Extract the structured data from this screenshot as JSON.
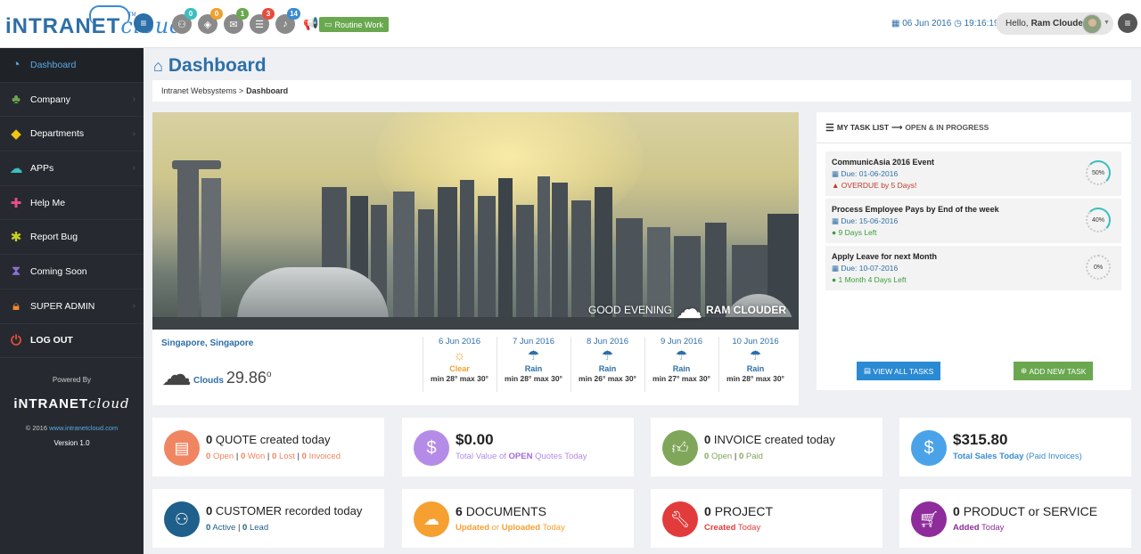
{
  "colors": {
    "brand": "#2d6fa8",
    "sidebar_bg": "#262a30",
    "accent_blue": "#5aa9e6"
  },
  "header": {
    "logo_left": "iNTRANET",
    "logo_right": "cloud",
    "logo_tm": "TM",
    "badges": [
      {
        "icon": "users-icon",
        "count": "0",
        "color": "#3bbfbf"
      },
      {
        "icon": "cube-icon",
        "count": "0",
        "color": "#f0a030"
      },
      {
        "icon": "chat-icon",
        "count": "1",
        "color": "#6aa84f"
      },
      {
        "icon": "list-icon",
        "count": "3",
        "color": "#e74c3c"
      },
      {
        "icon": "bell-icon",
        "count": "14",
        "color": "#3a8bd0"
      }
    ],
    "routine_label": "Routine Work",
    "date": "06 Jun 2016",
    "time": "19:16:19",
    "greeting": "Hello,",
    "user_name": "Ram Clouder"
  },
  "sidebar": {
    "items": [
      {
        "label": "Dashboard",
        "icon": "dashboard-icon"
      },
      {
        "label": "Company",
        "icon": "sitemap-icon"
      },
      {
        "label": "Departments",
        "icon": "cubes-icon"
      },
      {
        "label": "APPs",
        "icon": "cloud-icon"
      },
      {
        "label": "Help Me",
        "icon": "medkit-icon"
      },
      {
        "label": "Report Bug",
        "icon": "bug-icon"
      },
      {
        "label": "Coming Soon",
        "icon": "hourglass-icon"
      },
      {
        "label": "SUPER ADMIN",
        "icon": "lock-icon"
      },
      {
        "label": "LOG OUT",
        "icon": "power-icon"
      }
    ],
    "powered_by": "Powered By",
    "copyright": "© 2016",
    "copyright_link": "www.intranetcloud.com",
    "version": "Version 1.0"
  },
  "page": {
    "title": "Dashboard",
    "breadcrumb_root": "Intranet Websystems",
    "breadcrumb_sep": ">",
    "breadcrumb_current": "Dashboard"
  },
  "hero": {
    "greeting": "GOOD EVENING",
    "name": "RAM CLOUDER"
  },
  "weather": {
    "city": "Singapore, Singapore",
    "current_condition": "Clouds",
    "current_temp": "29.86",
    "degree": "o",
    "forecast": [
      {
        "date": "6 Jun 2016",
        "condition": "Clear",
        "range": "min 28° max 30°",
        "icon": "sun-icon"
      },
      {
        "date": "7 Jun 2016",
        "condition": "Rain",
        "range": "min 28° max 30°",
        "icon": "rain-icon"
      },
      {
        "date": "8 Jun 2016",
        "condition": "Rain",
        "range": "min 26° max 30°",
        "icon": "rain-icon"
      },
      {
        "date": "9 Jun 2016",
        "condition": "Rain",
        "range": "min 27° max 30°",
        "icon": "rain-icon"
      },
      {
        "date": "10 Jun 2016",
        "condition": "Rain",
        "range": "min 28° max 30°",
        "icon": "rain-icon"
      }
    ]
  },
  "tasks": {
    "heading": "MY TASK LIST",
    "heading_sub": "OPEN & IN PROGRESS",
    "items": [
      {
        "title": "CommunicAsia 2016 Event",
        "due": "Due: 01-06-2016",
        "status": "OVERDUE by 5 Days!",
        "progress": "50%",
        "progress_value": 50
      },
      {
        "title": "Process Employee Pays by End of the week",
        "due": "Due: 15-06-2016",
        "status": "9 Days Left",
        "progress": "40%",
        "progress_value": 40
      },
      {
        "title": "Apply Leave for next Month",
        "due": "Due: 10-07-2016",
        "status": "1 Month 4 Days Left",
        "progress": "0%",
        "progress_value": 0
      }
    ],
    "view_all_label": "VIEW ALL TASKS",
    "add_new_label": "ADD NEW TASK"
  },
  "stats": {
    "quote": {
      "count": "0",
      "label": "QUOTE created today",
      "open": "0",
      "open_l": "Open",
      "won": "0",
      "won_l": "Won",
      "lost": "0",
      "lost_l": "Lost",
      "inv": "0",
      "inv_l": "Invoiced"
    },
    "quote_value": {
      "amount": "$0.00",
      "pre": "Total Value of",
      "emph": "OPEN",
      "post": "Quotes Today"
    },
    "invoice": {
      "count": "0",
      "label": "INVOICE created today",
      "open": "0",
      "open_l": "Open",
      "paid": "0",
      "paid_l": "Paid"
    },
    "sales": {
      "amount": "$315.80",
      "label": "Total Sales Today",
      "note": "(Paid Invoices)"
    },
    "customer": {
      "count": "0",
      "label": "CUSTOMER recorded today",
      "active": "0",
      "active_l": "Active",
      "lead": "0",
      "lead_l": "Lead"
    },
    "documents": {
      "count": "6",
      "label": "DOCUMENTS",
      "updated": "Updated",
      "or": "or",
      "uploaded": "Uploaded",
      "today": "Today"
    },
    "project": {
      "count": "0",
      "label": "PROJECT",
      "created": "Created",
      "today": "Today"
    },
    "product": {
      "count": "0",
      "label": "PRODUCT or SERVICE",
      "added": "Added",
      "today": "Today"
    }
  }
}
